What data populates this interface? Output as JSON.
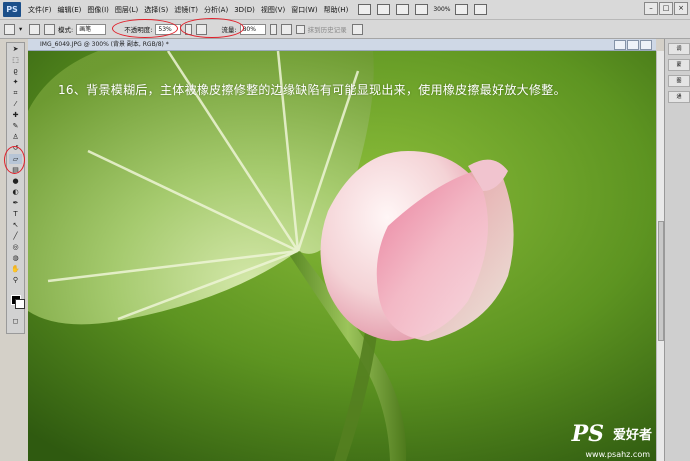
{
  "app": {
    "logo": "PS"
  },
  "menubar": {
    "items": [
      "文件(F)",
      "编辑(E)",
      "图像(I)",
      "图层(L)",
      "选择(S)",
      "滤镜(T)",
      "分析(A)",
      "3D(D)",
      "视图(V)",
      "窗口(W)",
      "帮助(H)"
    ],
    "zoom": "300%"
  },
  "options": {
    "mode_label": "模式:",
    "mode_value": "画笔",
    "opacity_label": "不透明度:",
    "opacity_value": "53%",
    "flow_label": "流量:",
    "flow_value": "80%",
    "history_label": "抹到历史记录"
  },
  "document": {
    "tab_title": "IMG_6049.JPG @ 300% (背景 副本, RGB/8) *"
  },
  "canvas": {
    "caption": "16、背景模糊后，主体被橡皮擦修整的边缘缺陷有可能显现出来，使用橡皮擦最好放大修整。",
    "watermark_ps": "PS",
    "watermark_cn": "爱好者",
    "watermark_url": "www.psahz.com"
  },
  "right_panel": {
    "items": [
      "调",
      "蒙",
      "图",
      "通"
    ]
  }
}
